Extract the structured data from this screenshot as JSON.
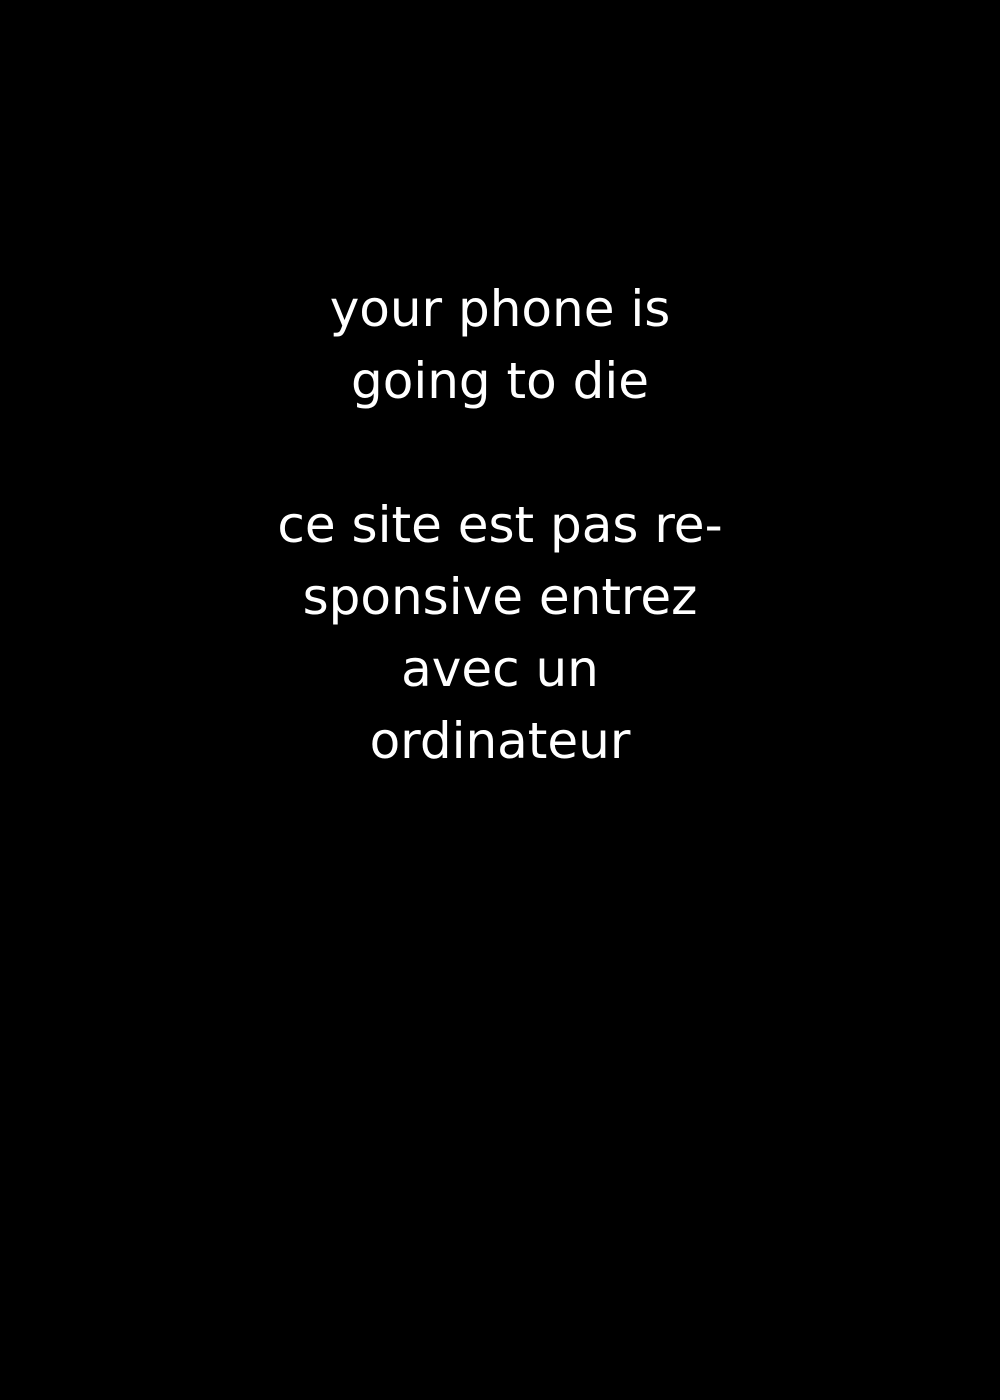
{
  "screen": {
    "background_color": "#000000",
    "text_color": "#ffffff",
    "message": {
      "line1": "your phone is",
      "line2": "going to die",
      "line3": "ce site est pas re-",
      "line4": "sponsive entrez",
      "line5": "avec un",
      "line6": "ordinateur"
    }
  }
}
